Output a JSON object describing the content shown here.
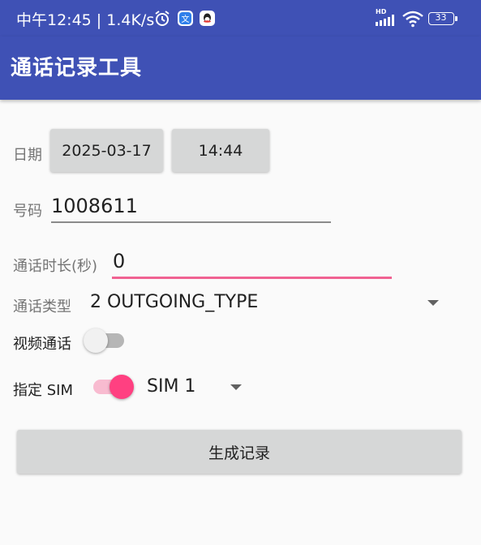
{
  "status_bar": {
    "time_speed": "中午12:45 | 1.4K/s",
    "hd_label": "HD",
    "battery_level": "33",
    "icons": [
      "alarm-icon",
      "translate-app-icon",
      "qq-app-icon",
      "cellular-signal-icon",
      "wifi-icon",
      "battery-icon"
    ]
  },
  "app_bar": {
    "title": "通话记录工具"
  },
  "date_row": {
    "label": "日期",
    "date_button": "2025-03-17",
    "time_button": "14:44"
  },
  "number_row": {
    "label": "号码",
    "value": "1008611"
  },
  "duration_row": {
    "label": "通话时长(秒)",
    "value": "0"
  },
  "type_row": {
    "label": "通话类型",
    "selected": "2 OUTGOING_TYPE"
  },
  "video_row": {
    "label": "视频通话",
    "enabled": false
  },
  "sim_row": {
    "label": "指定 SIM",
    "enabled": true,
    "selected": "SIM 1"
  },
  "generate_button": "生成记录",
  "colors": {
    "primary": "#3f51b5",
    "accent": "#ff4081",
    "button_gray": "#d6d7d7",
    "background": "#fafafa"
  }
}
